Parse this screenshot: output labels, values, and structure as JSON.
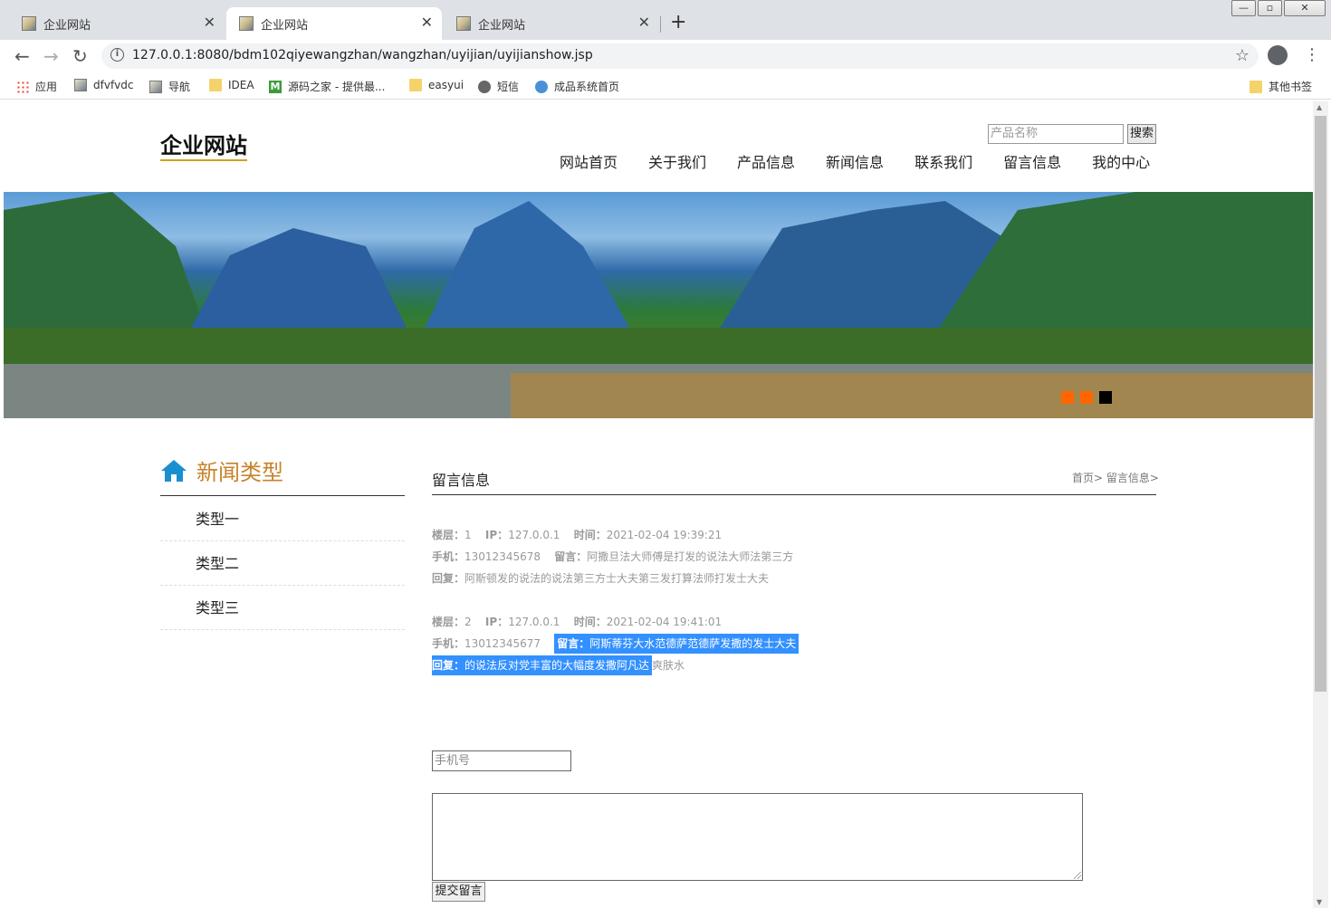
{
  "browser": {
    "tabs": [
      {
        "title": "企业网站"
      },
      {
        "title": "企业网站"
      },
      {
        "title": "企业网站"
      }
    ],
    "url": "127.0.0.1:8080/bdm102qiyewangzhan/wangzhan/uyijian/uyijianshow.jsp",
    "bookmarks": [
      {
        "label": "应用",
        "icon": "apps-icon"
      },
      {
        "label": "dfvfvdc",
        "icon": "image-icon"
      },
      {
        "label": "导航",
        "icon": "image-icon"
      },
      {
        "label": "IDEA",
        "icon": "folder-icon"
      },
      {
        "label": "源码之家 - 提供最...",
        "icon": "m-icon"
      },
      {
        "label": "easyui",
        "icon": "folder-icon"
      },
      {
        "label": "短信",
        "icon": "globe-icon"
      },
      {
        "label": "成品系统首页",
        "icon": "home-icon"
      }
    ],
    "other_bookmarks": "其他书签"
  },
  "site": {
    "logo": "企业网站",
    "search": {
      "placeholder": "产品名称",
      "button": "搜索"
    },
    "nav": [
      "网站首页",
      "关于我们",
      "产品信息",
      "新闻信息",
      "联系我们",
      "留言信息",
      "我的中心"
    ],
    "banner_dots": [
      "#ff6600",
      "#ff6600",
      "#000000"
    ]
  },
  "sidebar": {
    "title": "新闻类型",
    "items": [
      "类型一",
      "类型二",
      "类型三"
    ]
  },
  "content": {
    "title": "留言信息",
    "breadcrumb": "首页> 留言信息>",
    "messages": [
      {
        "floor_label": "楼层：",
        "floor": "1",
        "ip_label": "IP：",
        "ip": "127.0.0.1",
        "time_label": "时间：",
        "time": "2021-02-04 19:39:21",
        "phone_label": "手机：",
        "phone": "13012345678",
        "msg_label": "留言：",
        "msg": "阿撒旦法大师傅是打发的说法大师法第三方",
        "reply_label": "回复：",
        "reply": "阿斯顿发的说法的说法第三方士大夫第三发打算法师打发士大夫"
      },
      {
        "floor_label": "楼层：",
        "floor": "2",
        "ip_label": "IP：",
        "ip": "127.0.0.1",
        "time_label": "时间：",
        "time": "2021-02-04 19:41:01",
        "phone_label": "手机：",
        "phone": "13012345677",
        "msg_label": "留言：",
        "msg": "阿斯蒂芬大水范德萨范德萨发撒的发士大夫",
        "reply_label": "回复：",
        "reply_selected": "的说法反对党丰富的大幅度发撒阿凡达",
        "reply_rest": "爽肤水"
      }
    ],
    "form": {
      "phone_placeholder": "手机号",
      "submit": "提交留言"
    }
  }
}
